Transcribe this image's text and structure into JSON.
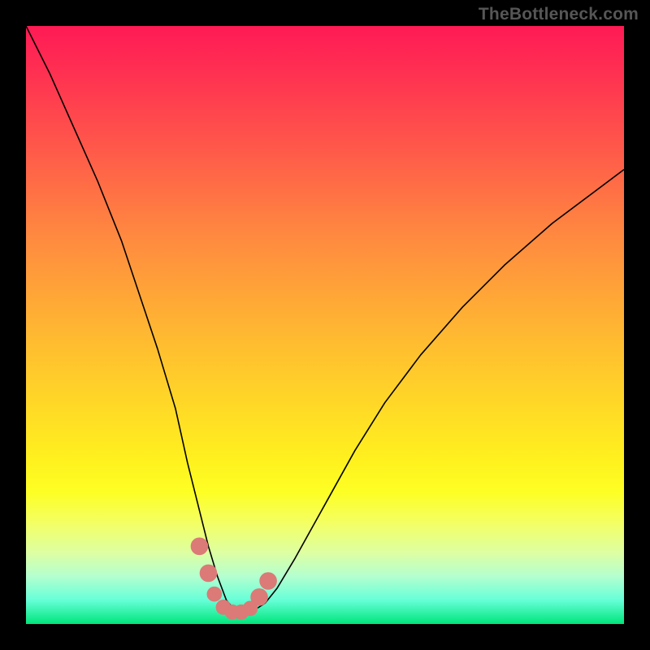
{
  "watermark": "TheBottleneck.com",
  "colors": {
    "frame": "#000000",
    "curve": "#000000",
    "marker": "#db7a77",
    "gradient_css": "linear-gradient(to bottom, #ff1a55 0%, #ff2e52 7%, #ff574a 20%, #ff8c3f 36%, #ffc22e 55%, #fff21e 73%, #fdff24 78%, #f4ff62 83%, #deffa1 88%, #b4ffcf 92%, #66ffd8 96%, #00e57a 100%)"
  },
  "chart_data": {
    "type": "line",
    "title": "",
    "xlabel": "",
    "ylabel": "",
    "xlim": [
      0,
      100
    ],
    "ylim": [
      0,
      100
    ],
    "grid": false,
    "legend": false,
    "series": [
      {
        "name": "bottleneck-curve",
        "x": [
          0,
          4,
          8,
          12,
          16,
          19,
          22,
          25,
          27,
          29,
          30.5,
          32,
          33.5,
          35,
          36.5,
          38,
          40,
          42,
          45,
          50,
          55,
          60,
          66,
          73,
          80,
          88,
          96,
          100
        ],
        "y": [
          100,
          92,
          83,
          74,
          64,
          55,
          46,
          36,
          27,
          19,
          13,
          8,
          4,
          2.2,
          2.0,
          2.2,
          3.5,
          6,
          11,
          20,
          29,
          37,
          45,
          53,
          60,
          67,
          73,
          76
        ]
      }
    ],
    "markers": {
      "name": "highlight-points",
      "x": [
        29,
        30.5,
        31.5,
        33,
        34.5,
        36,
        37.5,
        39,
        40.5
      ],
      "y": [
        13,
        8.5,
        5.0,
        2.8,
        2.0,
        2.0,
        2.6,
        4.5,
        7.2
      ],
      "r": [
        1.4,
        1.4,
        1.2,
        1.2,
        1.2,
        1.2,
        1.2,
        1.4,
        1.4
      ]
    }
  }
}
